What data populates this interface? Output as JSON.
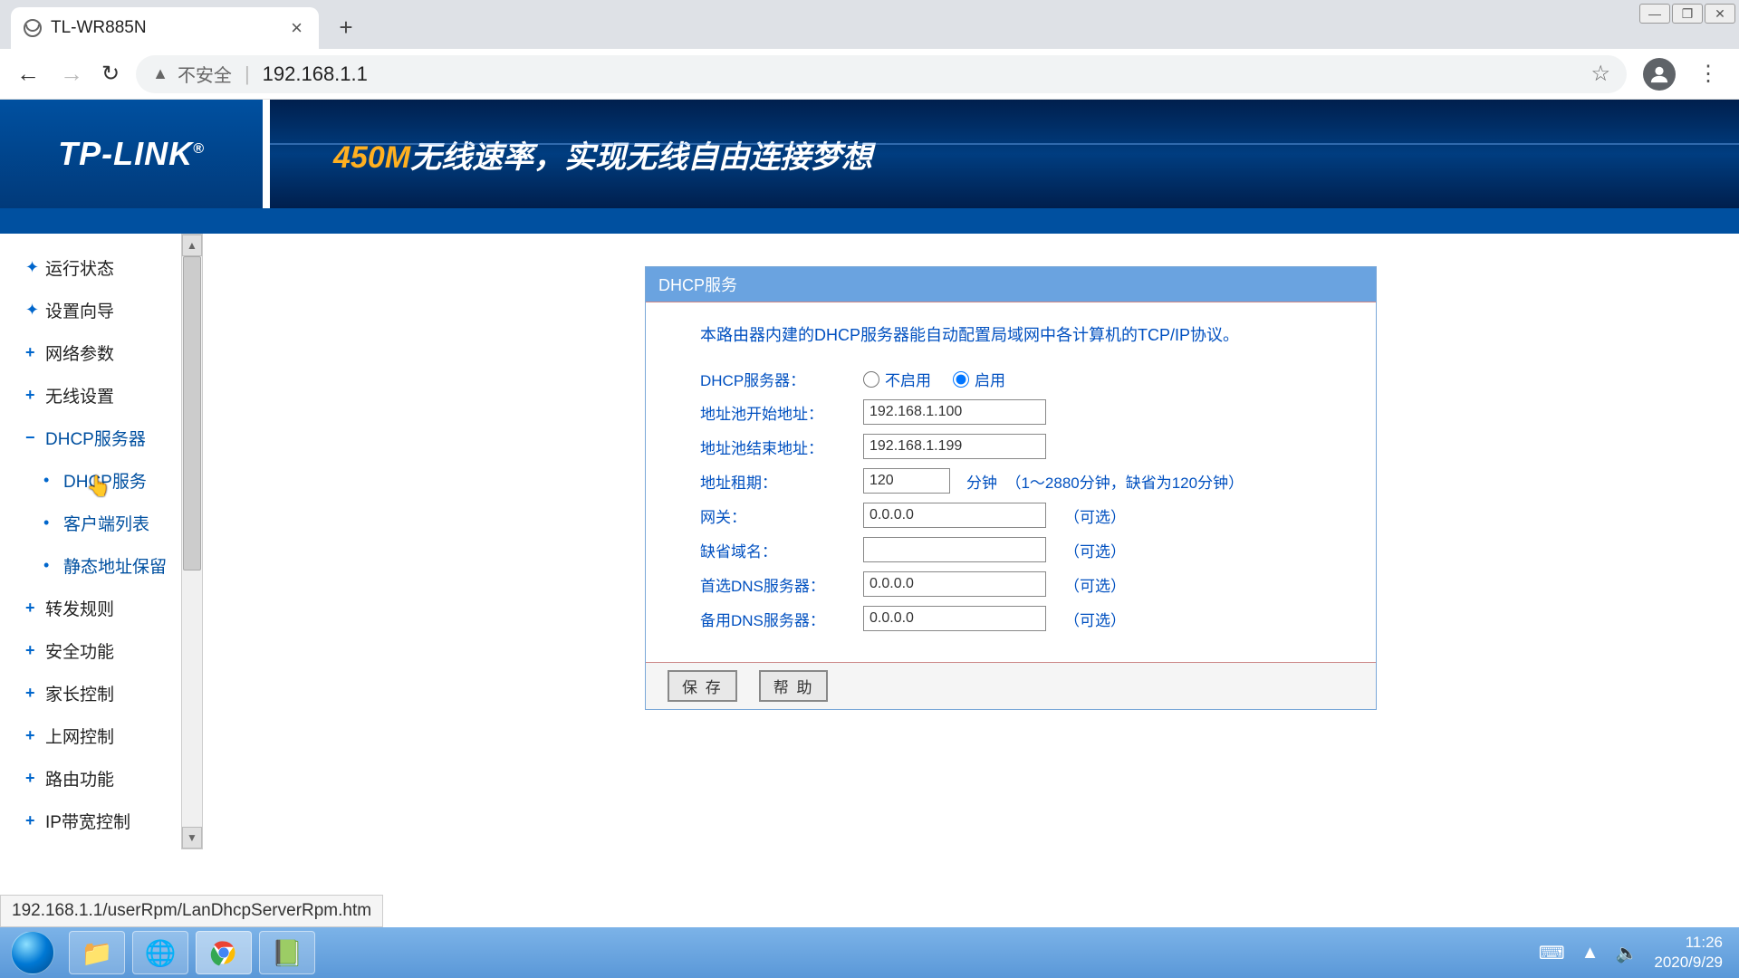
{
  "window": {
    "minimize": "—",
    "maximize": "❐",
    "close": "✕"
  },
  "browser": {
    "tab_title": "TL-WR885N",
    "security_label": "不安全",
    "url": "192.168.1.1"
  },
  "banner": {
    "logo": "TP-LINK",
    "logo_r": "®",
    "speed": "450M",
    "slogan": "无线速率，实现无线自由连接梦想"
  },
  "sidebar": {
    "items": [
      {
        "label": "运行状态",
        "type": "plus"
      },
      {
        "label": "设置向导",
        "type": "plus"
      },
      {
        "label": "网络参数",
        "type": "plus"
      },
      {
        "label": "无线设置",
        "type": "plus"
      },
      {
        "label": "DHCP服务器",
        "type": "minus"
      },
      {
        "label": "DHCP服务",
        "type": "sub"
      },
      {
        "label": "客户端列表",
        "type": "sub"
      },
      {
        "label": "静态地址保留",
        "type": "sub"
      },
      {
        "label": "转发规则",
        "type": "plus"
      },
      {
        "label": "安全功能",
        "type": "plus"
      },
      {
        "label": "家长控制",
        "type": "plus"
      },
      {
        "label": "上网控制",
        "type": "plus"
      },
      {
        "label": "路由功能",
        "type": "plus"
      },
      {
        "label": "IP带宽控制",
        "type": "plus"
      }
    ]
  },
  "panel": {
    "title": "DHCP服务",
    "intro": "本路由器内建的DHCP服务器能自动配置局域网中各计算机的TCP/IP协议。",
    "labels": {
      "server": "DHCP服务器：",
      "disable": "不启用",
      "enable": "启用",
      "start": "地址池开始地址：",
      "end": "地址池结束地址：",
      "lease": "地址租期：",
      "lease_unit": "分钟",
      "lease_hint": "（1～2880分钟，缺省为120分钟）",
      "gateway": "网关：",
      "domain": "缺省域名：",
      "dns1": "首选DNS服务器：",
      "dns2": "备用DNS服务器：",
      "optional": "（可选）"
    },
    "values": {
      "start_ip": "192.168.1.100",
      "end_ip": "192.168.1.199",
      "lease": "120",
      "gateway": "0.0.0.0",
      "domain": "",
      "dns1": "0.0.0.0",
      "dns2": "0.0.0.0"
    },
    "buttons": {
      "save": "保 存",
      "help": "帮 助"
    }
  },
  "status_url": "192.168.1.1/userRpm/LanDhcpServerRpm.htm",
  "taskbar": {
    "time": "11:26",
    "date": "2020/9/29"
  }
}
